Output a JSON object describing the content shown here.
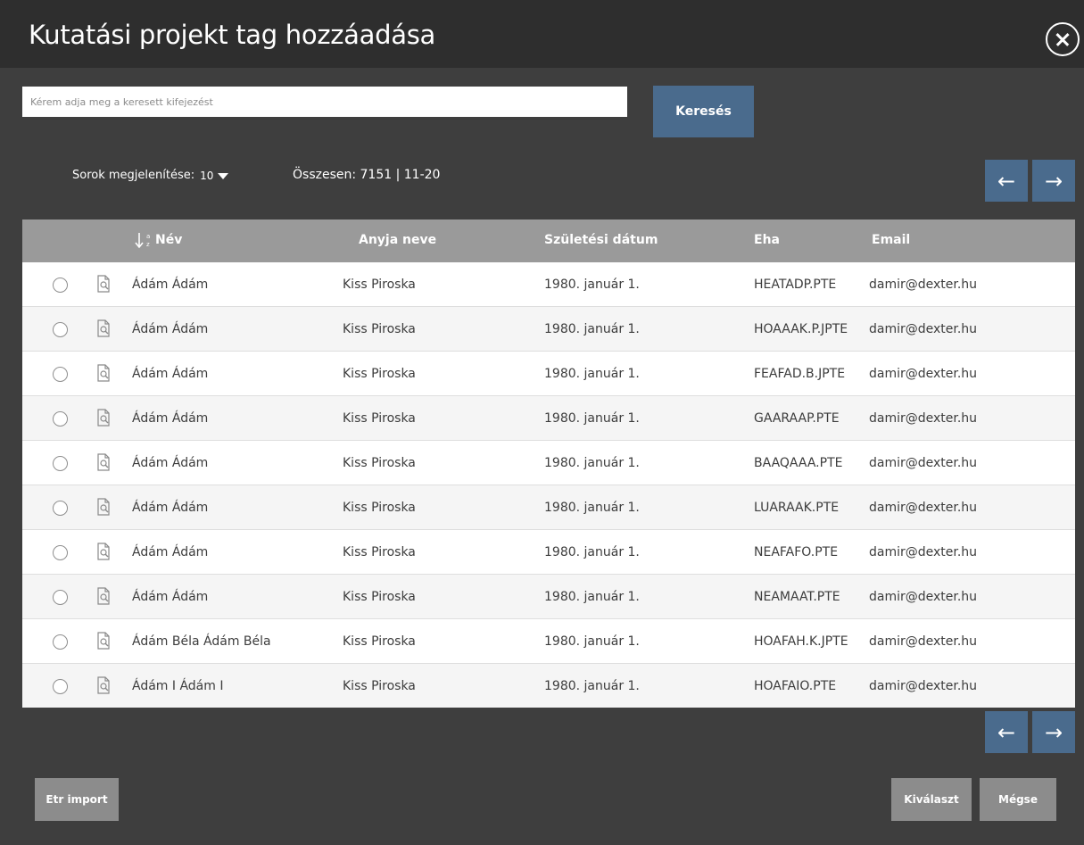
{
  "dialog": {
    "title": "Kutatási projekt tag hozzáadása"
  },
  "search": {
    "placeholder": "Kérem adja meg a keresett kifejezést",
    "value": "",
    "button_label": "Keresés"
  },
  "paging": {
    "rows_label": "Sorok megjelenítése:",
    "rows_value": "10",
    "total_text": "Összesen: 7151 | 11-20",
    "prev_icon": "←",
    "next_icon": "→"
  },
  "table": {
    "sort_icon": "sort-az-descending-icon",
    "columns": [
      "Név",
      "Anyja neve",
      "Születési dátum",
      "Eha",
      "Email"
    ],
    "rows": [
      {
        "name": "Ádám Ádám",
        "mother": "Kiss Piroska",
        "birth": "1980. január 1.",
        "eha": "HEATADP.PTE",
        "email": "damir@dexter.hu"
      },
      {
        "name": "Ádám Ádám",
        "mother": "Kiss Piroska",
        "birth": "1980. január 1.",
        "eha": "HOAAAK.P.JPTE",
        "email": "damir@dexter.hu"
      },
      {
        "name": "Ádám Ádám",
        "mother": "Kiss Piroska",
        "birth": "1980. január 1.",
        "eha": "FEAFAD.B.JPTE",
        "email": "damir@dexter.hu"
      },
      {
        "name": "Ádám Ádám",
        "mother": "Kiss Piroska",
        "birth": "1980. január 1.",
        "eha": "GAARAAP.PTE",
        "email": "damir@dexter.hu"
      },
      {
        "name": "Ádám Ádám",
        "mother": "Kiss Piroska",
        "birth": "1980. január 1.",
        "eha": "BAAQAAA.PTE",
        "email": "damir@dexter.hu"
      },
      {
        "name": "Ádám Ádám",
        "mother": "Kiss Piroska",
        "birth": "1980. január 1.",
        "eha": "LUARAAK.PTE",
        "email": "damir@dexter.hu"
      },
      {
        "name": "Ádám Ádám",
        "mother": "Kiss Piroska",
        "birth": "1980. január 1.",
        "eha": "NEAFAFO.PTE",
        "email": "damir@dexter.hu"
      },
      {
        "name": "Ádám Ádám",
        "mother": "Kiss Piroska",
        "birth": "1980. január 1.",
        "eha": "NEAMAAT.PTE",
        "email": "damir@dexter.hu"
      },
      {
        "name": "Ádám Béla Ádám Béla",
        "mother": "Kiss Piroska",
        "birth": "1980. január 1.",
        "eha": "HOAFAH.K.JPTE",
        "email": "damir@dexter.hu"
      },
      {
        "name": "Ádám I Ádám I",
        "mother": "Kiss Piroska",
        "birth": "1980. január 1.",
        "eha": "HOAFAIO.PTE",
        "email": "damir@dexter.hu"
      }
    ]
  },
  "footer": {
    "etr_label": "Etr import",
    "select_label": "Kiválaszt",
    "cancel_label": "Mégse"
  },
  "colors": {
    "background": "#3e3e3e",
    "titlebar": "#2e2e2e",
    "accent_blue": "#4a6b8d",
    "header_gray": "#9a9a9a",
    "button_gray": "#8c8c8c"
  }
}
